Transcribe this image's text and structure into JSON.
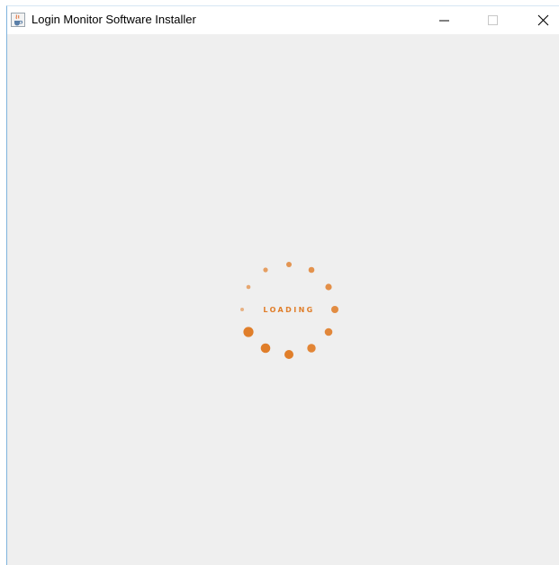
{
  "window": {
    "title": "Login Monitor Software Installer",
    "app_icon": "java-cup-icon",
    "controls": {
      "minimize_icon": "minimize-icon",
      "maximize_icon": "maximize-icon",
      "close_icon": "close-icon"
    }
  },
  "loader": {
    "text": "LOADING",
    "color": "#e07e2a",
    "icon": "loading-spinner-icon"
  }
}
